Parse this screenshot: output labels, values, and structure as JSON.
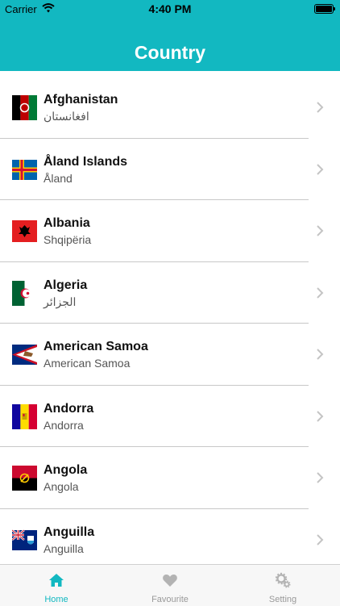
{
  "status_bar": {
    "carrier": "Carrier",
    "time": "4:40 PM"
  },
  "header": {
    "title": "Country",
    "color": "#12b8c1"
  },
  "countries": [
    {
      "name": "Afghanistan",
      "native": "افغانستان",
      "flag": "afghanistan-flag"
    },
    {
      "name": "Åland Islands",
      "native": "Åland",
      "flag": "aland-flag"
    },
    {
      "name": "Albania",
      "native": "Shqipëria",
      "flag": "albania-flag"
    },
    {
      "name": "Algeria",
      "native": "الجزائر",
      "flag": "algeria-flag"
    },
    {
      "name": "American Samoa",
      "native": "American Samoa",
      "flag": "american-samoa-flag"
    },
    {
      "name": "Andorra",
      "native": "Andorra",
      "flag": "andorra-flag"
    },
    {
      "name": "Angola",
      "native": "Angola",
      "flag": "angola-flag"
    },
    {
      "name": "Anguilla",
      "native": "Anguilla",
      "flag": "anguilla-flag"
    }
  ],
  "tabbar": {
    "home": {
      "label": "Home",
      "icon": "house-icon",
      "active": true
    },
    "favourite": {
      "label": "Favourite",
      "icon": "heart-icon"
    },
    "setting": {
      "label": "Setting",
      "icon": "gear-icon"
    }
  }
}
